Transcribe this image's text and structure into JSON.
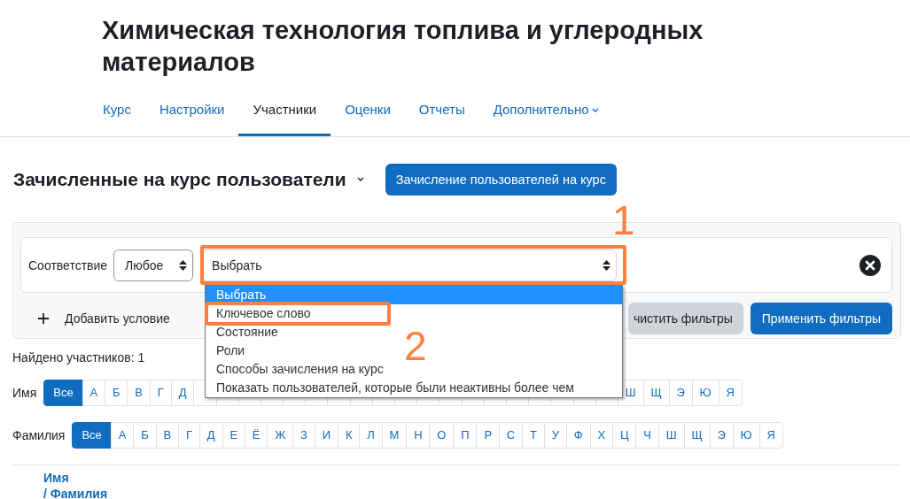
{
  "course_title": "Химическая технология топлива и углеродных материалов",
  "nav_tabs": [
    {
      "label": "Курс",
      "selected": false,
      "kind": "link"
    },
    {
      "label": "Настройки",
      "selected": false,
      "kind": "link"
    },
    {
      "label": "Участники",
      "selected": true,
      "kind": "link"
    },
    {
      "label": "Оценки",
      "selected": false,
      "kind": "link"
    },
    {
      "label": "Отчеты",
      "selected": false,
      "kind": "link"
    },
    {
      "label": "Дополнительно",
      "selected": false,
      "kind": "menu"
    }
  ],
  "page_heading": "Зачисленные на курс пользователи",
  "enrol_button": "Зачисление пользователей на курс",
  "filter": {
    "match_label": "Соответствие",
    "match_value": "Любое",
    "condition_value": "Выбрать",
    "options": [
      {
        "label": "Выбрать",
        "selected": true
      },
      {
        "label": "Ключевое слово",
        "selected": false
      },
      {
        "label": "Состояние",
        "selected": false
      },
      {
        "label": "Роли",
        "selected": false
      },
      {
        "label": "Способы зачисления на курс",
        "selected": false
      },
      {
        "label": "Показать пользователей, которые были неактивны более чем",
        "selected": false
      }
    ],
    "add_condition": "Добавить условие",
    "clear_button": "чистить фильтры",
    "apply_button": "Применить фильтры"
  },
  "found": "Найдено участников: 1",
  "initials": [
    {
      "label": "Имя",
      "letters": [
        {
          "label": "Все",
          "selected": true
        },
        {
          "label": "А",
          "selected": false
        },
        {
          "label": "Б",
          "selected": false
        },
        {
          "label": "В",
          "selected": false
        },
        {
          "label": "Г",
          "selected": false
        },
        {
          "label": "Д",
          "selected": false
        },
        {
          "kind": "covered"
        },
        {
          "kind": "covered"
        },
        {
          "kind": "covered"
        },
        {
          "kind": "covered"
        },
        {
          "kind": "covered"
        },
        {
          "kind": "covered"
        },
        {
          "kind": "covered"
        },
        {
          "kind": "covered"
        },
        {
          "kind": "covered"
        },
        {
          "kind": "covered"
        },
        {
          "kind": "covered"
        },
        {
          "kind": "covered"
        },
        {
          "kind": "covered"
        },
        {
          "kind": "covered"
        },
        {
          "kind": "covered"
        },
        {
          "kind": "covered"
        },
        {
          "kind": "covered"
        },
        {
          "kind": "covered"
        },
        {
          "kind": "covered"
        },
        {
          "label": "Ш",
          "selected": false
        },
        {
          "label": "Щ",
          "selected": false
        },
        {
          "label": "Э",
          "selected": false
        },
        {
          "label": "Ю",
          "selected": false
        },
        {
          "label": "Я",
          "selected": false
        }
      ]
    },
    {
      "label": "Фамилия",
      "letters": [
        {
          "label": "Все",
          "selected": true
        },
        {
          "label": "А",
          "selected": false
        },
        {
          "label": "Б",
          "selected": false
        },
        {
          "label": "В",
          "selected": false
        },
        {
          "label": "Г",
          "selected": false
        },
        {
          "label": "Д",
          "selected": false
        },
        {
          "label": "Е",
          "selected": false
        },
        {
          "label": "Ё",
          "selected": false
        },
        {
          "label": "Ж",
          "selected": false
        },
        {
          "label": "З",
          "selected": false
        },
        {
          "label": "И",
          "selected": false
        },
        {
          "label": "К",
          "selected": false
        },
        {
          "label": "Л",
          "selected": false
        },
        {
          "label": "М",
          "selected": false
        },
        {
          "label": "Н",
          "selected": false
        },
        {
          "label": "О",
          "selected": false
        },
        {
          "label": "П",
          "selected": false
        },
        {
          "label": "Р",
          "selected": false
        },
        {
          "label": "С",
          "selected": false
        },
        {
          "label": "Т",
          "selected": false
        },
        {
          "label": "У",
          "selected": false
        },
        {
          "label": "Ф",
          "selected": false
        },
        {
          "label": "Х",
          "selected": false
        },
        {
          "label": "Ц",
          "selected": false
        },
        {
          "label": "Ч",
          "selected": false
        },
        {
          "label": "Ш",
          "selected": false
        },
        {
          "label": "Щ",
          "selected": false
        },
        {
          "label": "Э",
          "selected": false
        },
        {
          "label": "Ю",
          "selected": false
        },
        {
          "label": "Я",
          "selected": false
        }
      ]
    }
  ],
  "table_header": {
    "first_name": "Имя",
    "last_name": "/ Фамилия"
  },
  "annotations": [
    {
      "label": "1"
    },
    {
      "label": "2"
    }
  ]
}
